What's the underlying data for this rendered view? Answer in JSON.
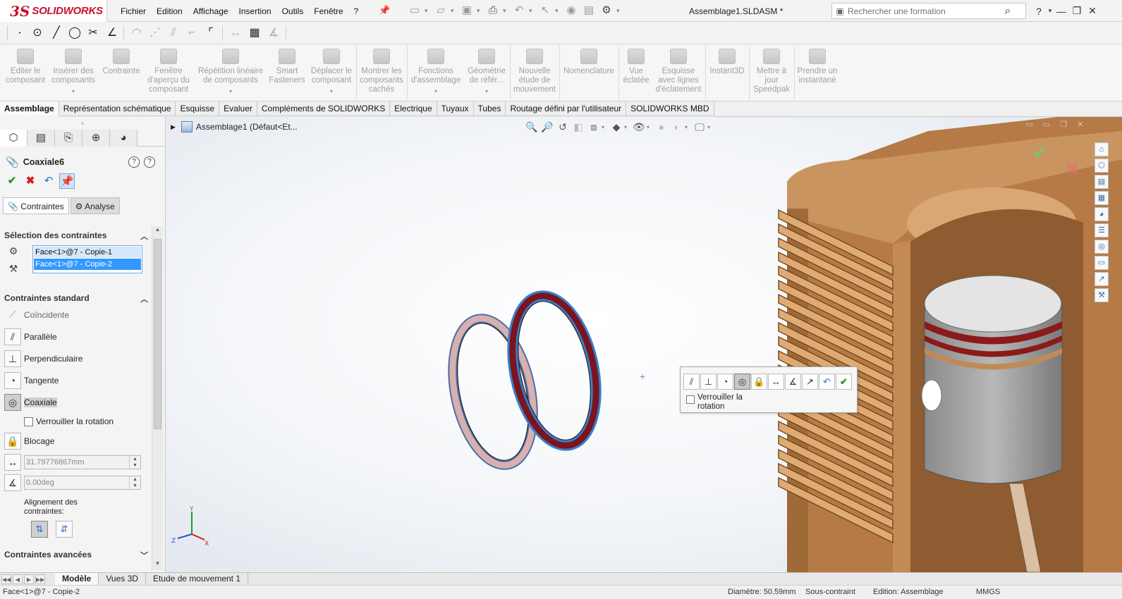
{
  "app": {
    "logo_ds": "3S",
    "logo_name": "SOLIDWORKS",
    "document_title": "Assemblage1.SLDASM *",
    "accent_color": "#c8102e"
  },
  "menu": [
    "Fichier",
    "Edition",
    "Affichage",
    "Insertion",
    "Outils",
    "Fenêtre",
    "?"
  ],
  "search": {
    "placeholder": "Rechercher une formation"
  },
  "command_manager": [
    {
      "label": "Editer le composant",
      "caret": false
    },
    {
      "label": "Insérer des composants",
      "caret": true
    },
    {
      "label": "Contrainte",
      "caret": false
    },
    {
      "label": "Fenêtre d'aperçu du composant",
      "caret": false
    },
    {
      "label": "Répétition linéaire de composants",
      "caret": true
    },
    {
      "label": "Smart Fasteners",
      "caret": false
    },
    {
      "label": "Déplacer le composant",
      "caret": true
    },
    {
      "label": "Montrer les composants cachés",
      "caret": false
    },
    {
      "label": "Fonctions d'assemblage",
      "caret": true
    },
    {
      "label": "Géométrie de référ...",
      "caret": true
    },
    {
      "label": "Nouvelle étude de mouvement",
      "caret": false
    },
    {
      "label": "Nomenclature",
      "caret": false
    },
    {
      "label": "Vue éclatée",
      "caret": false
    },
    {
      "label": "Esquisse avec lignes d'éclatement",
      "caret": false
    },
    {
      "label": "Instant3D",
      "caret": false
    },
    {
      "label": "Mettre à jour Speedpak",
      "caret": false
    },
    {
      "label": "Prendre un instantané",
      "caret": false
    }
  ],
  "tabs": [
    "Assemblage",
    "Représentation schématique",
    "Esquisse",
    "Evaluer",
    "Compléments de SOLIDWORKS",
    "Electrique",
    "Tuyaux",
    "Tubes",
    "Routage défini par l'utilisateur",
    "SOLIDWORKS MBD"
  ],
  "property_manager": {
    "title": "Coaxiale6",
    "subtabs": [
      "Contraintes",
      "Analyse"
    ],
    "selection_section": "Sélection des contraintes",
    "selections": [
      "Face<1>@7 - Copie-1",
      "Face<1>@7 - Copie-2"
    ],
    "standard_section": "Contraintes standard",
    "mates": {
      "coincident": "Coïncidente",
      "parallel": "Parallèle",
      "perpendicular": "Perpendiculaire",
      "tangent": "Tangente",
      "concentric": "Coaxiale",
      "lock_rotation": "Verrouiller la rotation",
      "lock": "Blocage"
    },
    "distance_value": "31.79776867mm",
    "angle_value": "0.00deg",
    "alignment_label": "Alignement des contraintes:",
    "advanced_section": "Contraintes avancées"
  },
  "tree": {
    "root": "Assemblage1",
    "config": "(Défaut<Et..."
  },
  "popup": {
    "lock_rotation": "Verrouiller la rotation"
  },
  "triad": {
    "x": "X",
    "y": "Y",
    "z": "Z"
  },
  "bottom_tabs": [
    "Modèle",
    "Vues 3D",
    "Etude de mouvement 1"
  ],
  "status": {
    "left": "Face<1>@7 - Copie-2",
    "diameter": "Diamètre: 50.59mm",
    "constraint": "Sous-contraint",
    "editing": "Edition: Assemblage",
    "units": "MMGS"
  }
}
